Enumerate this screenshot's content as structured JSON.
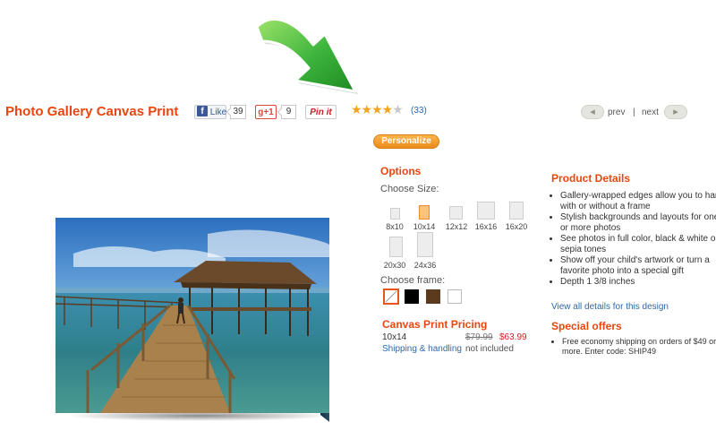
{
  "title": "Photo Gallery Canvas Print",
  "social": {
    "facebook_label": "Like",
    "facebook_icon": "f",
    "facebook_count": "39",
    "gplus_label": "g+1",
    "gplus_count": "9",
    "pinterest_label": "Pin it"
  },
  "rating": {
    "stars_full": "★★★★",
    "stars_half": "★",
    "stars_value": 4.5,
    "review_count": "(33)"
  },
  "nav": {
    "prev_arrow": "◂",
    "prev_label": "prev",
    "separator": "|",
    "next_label": "next",
    "next_arrow": "▸"
  },
  "personalize_label": "Personalize",
  "options": {
    "heading": "Options",
    "choose_size_label": "Choose Size:",
    "sizes": [
      "8x10",
      "10x14",
      "12x12",
      "16x16",
      "16x20",
      "20x30",
      "24x36"
    ],
    "selected_size": "10x14",
    "choose_frame_label": "Choose frame:",
    "frames": [
      "none",
      "black",
      "brown",
      "white"
    ],
    "selected_frame": "none"
  },
  "pricing": {
    "heading": "Canvas Print Pricing",
    "size": "10x14",
    "old_price": "$79.99",
    "new_price": "$63.99",
    "shipping_link": "Shipping & handling",
    "shipping_note": "not included"
  },
  "details": {
    "heading": "Product Details",
    "items": [
      "Gallery-wrapped edges allow you to hang with or without a frame",
      "Stylish backgrounds and layouts for one or more photos",
      "See photos in full color, black & white or sepia tones",
      "Show off your child's artwork or turn a favorite photo into a special gift",
      "Depth 1 3/8 inches"
    ],
    "view_all": "View all details for this design"
  },
  "offers": {
    "heading": "Special offers",
    "items": [
      "Free economy shipping on orders of $49 or more. Enter code: SHIP49"
    ]
  },
  "colors": {
    "accent_orange": "#e8460f",
    "link_blue": "#2e68a8",
    "sale_red": "#d42020",
    "arrow_green": "#3cb43c"
  }
}
